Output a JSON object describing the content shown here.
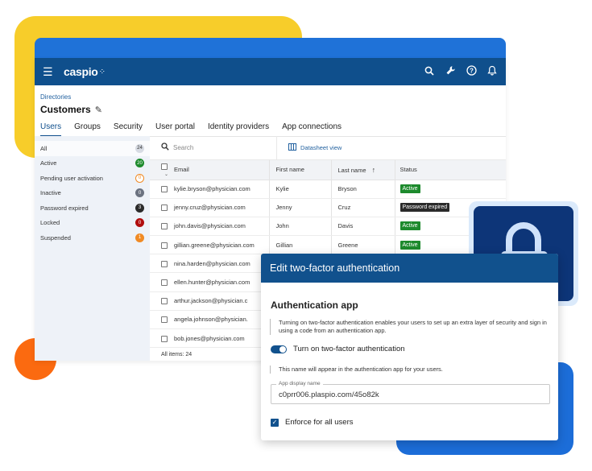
{
  "topbar": {
    "logo": "caspio",
    "logo_mark": "⁘",
    "icons": [
      "search-icon",
      "wrench-icon",
      "help-icon",
      "bell-icon"
    ]
  },
  "breadcrumb": "Directories",
  "page_title": "Customers",
  "tabs": [
    {
      "label": "Users",
      "active": true
    },
    {
      "label": "Groups"
    },
    {
      "label": "Security"
    },
    {
      "label": "User portal"
    },
    {
      "label": "Identity providers"
    },
    {
      "label": "App connections"
    }
  ],
  "sidebar": {
    "items": [
      {
        "label": "All",
        "count": "24",
        "color": "#d7dbe3",
        "text_color": "#333333",
        "active": true
      },
      {
        "label": "Active",
        "count": "20",
        "color": "#1d8a2d"
      },
      {
        "label": "Pending user activation",
        "count": "0",
        "color": "#ffffff",
        "text_color": "#f08a24",
        "border": "#f08a24"
      },
      {
        "label": "Inactive",
        "count": "0",
        "color": "#6b7280"
      },
      {
        "label": "Password expired",
        "count": "3",
        "color": "#2b2b2b"
      },
      {
        "label": "Locked",
        "count": "0",
        "color": "#b00d0d"
      },
      {
        "label": "Suspended",
        "count": "1",
        "color": "#f08a24"
      }
    ]
  },
  "toolbar": {
    "search_placeholder": "Search",
    "datasheet_label": "Datasheet view"
  },
  "table": {
    "headers": {
      "email": "Email",
      "first": "First name",
      "last": "Last name",
      "sort_icon": "↑",
      "status": "Status"
    },
    "rows": [
      {
        "email": "kylie.bryson@physician.com",
        "first": "Kylie",
        "last": "Bryson",
        "status": "Active",
        "status_type": "active"
      },
      {
        "email": "jenny.cruz@physician.com",
        "first": "Jenny",
        "last": "Cruz",
        "status": "Password expired",
        "status_type": "expired"
      },
      {
        "email": "john.davis@physician.com",
        "first": "John",
        "last": "Davis",
        "status": "Active",
        "status_type": "active"
      },
      {
        "email": "gillian.greene@physician.com",
        "first": "Gillian",
        "last": "Greene",
        "status": "Active",
        "status_type": "active"
      },
      {
        "email": "nina.harden@physician.com",
        "first": "",
        "last": "",
        "status": "",
        "status_type": ""
      },
      {
        "email": "ellen.hunter@physician.com",
        "first": "",
        "last": "",
        "status": "",
        "status_type": ""
      },
      {
        "email": "arthur.jackson@physician.c",
        "first": "",
        "last": "",
        "status": "",
        "status_type": ""
      },
      {
        "email": "angela.johnson@physician.",
        "first": "",
        "last": "",
        "status": "",
        "status_type": ""
      },
      {
        "email": "bob.jones@physician.com",
        "first": "",
        "last": "",
        "status": "",
        "status_type": ""
      }
    ],
    "footer": "All items:  24"
  },
  "modal": {
    "title": "Edit two-factor authentication",
    "section_title": "Authentication app",
    "description": "Turning on two-factor authentication enables your users to set up an extra layer of security and sign in using a code from an authentication app.",
    "toggle_label": "Turn on two-factor authentication",
    "toggle_on": true,
    "name_note": "This name will appear in the authentication app for your users.",
    "field_label": "App display name",
    "field_value": "c0prr006.plaspio.com/45o82k",
    "enforce_label": "Enforce for all users",
    "enforce_checked": true
  },
  "colors": {
    "brand_navy": "#0f4f8c",
    "accent_yellow": "#f7cd2a",
    "accent_blue": "#1c6dd8",
    "accent_orange": "#fb6a10",
    "lock_bg": "#0d3578"
  }
}
